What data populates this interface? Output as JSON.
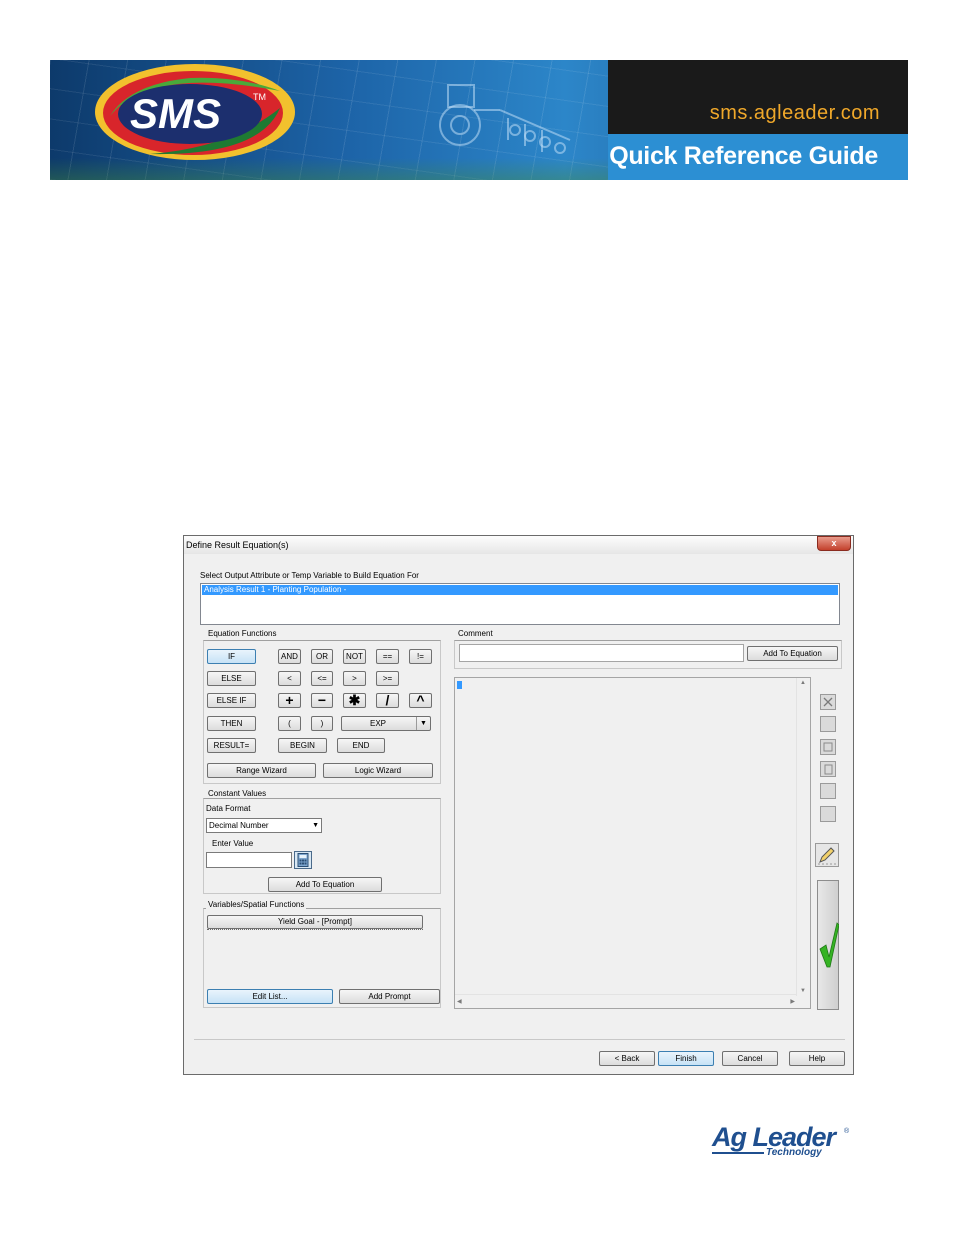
{
  "banner": {
    "logo_text": "SMS",
    "logo_tm": "TM",
    "url": "sms.agleader.com",
    "guide_title": "Quick Reference Guide"
  },
  "dialog": {
    "title": "Define Result Equation(s)",
    "close_symbol": "x",
    "select_label": "Select Output Attribute or Temp Variable to Build Equation For",
    "selected_output": "Analysis Result 1 - Planting Population -",
    "equation_functions": {
      "label": "Equation Functions",
      "if": "IF",
      "and": "AND",
      "or": "OR",
      "not": "NOT",
      "eq": "==",
      "neq": "!=",
      "else": "ELSE",
      "lt": "<",
      "lte": "<=",
      "gt": ">",
      "gte": ">=",
      "else_if": "ELSE IF",
      "plus": "+",
      "minus": "−",
      "times": "✱",
      "divide": "/",
      "power": "^",
      "then": "THEN",
      "lparen": "(",
      "rparen": ")",
      "exp": "EXP",
      "result": "RESULT=",
      "begin": "BEGIN",
      "end": "END",
      "range_wizard": "Range Wizard",
      "logic_wizard": "Logic Wizard"
    },
    "comment": {
      "label": "Comment",
      "value": "",
      "add_button": "Add To Equation"
    },
    "constant_values": {
      "label": "Constant Values",
      "data_format_label": "Data Format",
      "data_format_value": "Decimal Number",
      "enter_value_label": "Enter Value",
      "value": "",
      "add_button": "Add To Equation"
    },
    "variables": {
      "label": "Variables/Spatial Functions",
      "items": [
        "Yield Goal - [Prompt]"
      ],
      "edit_list": "Edit List...",
      "add_prompt": "Add Prompt"
    },
    "footer": {
      "back": "< Back",
      "finish": "Finish",
      "cancel": "Cancel",
      "help": "Help"
    }
  },
  "agleader": {
    "name": "Ag Leader",
    "sub": "Technology",
    "reg": "®"
  }
}
